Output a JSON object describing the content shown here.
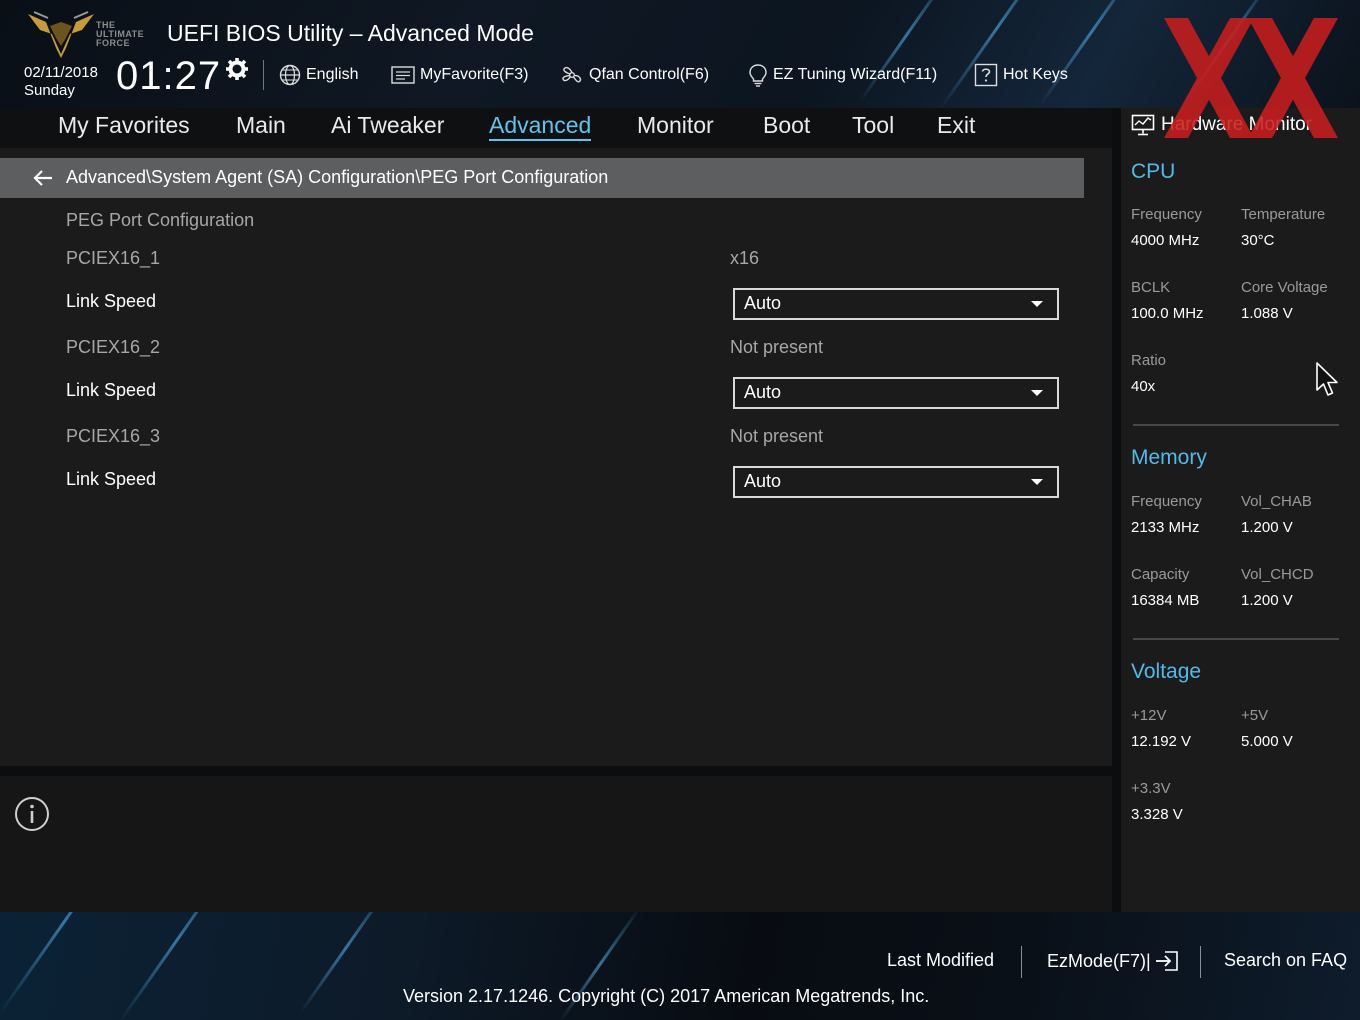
{
  "header": {
    "logo_text": "THE ULTIMATE FORCE",
    "title": "UEFI BIOS Utility – Advanced Mode",
    "date": "02/11/2018",
    "day": "Sunday",
    "time": "01:27",
    "toolbar": [
      {
        "label": "English",
        "icon": "globe-icon"
      },
      {
        "label": "MyFavorite(F3)",
        "icon": "favorite-list-icon"
      },
      {
        "label": "Qfan Control(F6)",
        "icon": "fan-icon"
      },
      {
        "label": "EZ Tuning Wizard(F11)",
        "icon": "lightbulb-icon"
      },
      {
        "label": "Hot Keys",
        "icon": "help-box-icon"
      }
    ]
  },
  "menu": {
    "tabs": [
      "My Favorites",
      "Main",
      "Ai Tweaker",
      "Advanced",
      "Monitor",
      "Boot",
      "Tool",
      "Exit"
    ],
    "active": "Advanced"
  },
  "main": {
    "breadcrumb": "Advanced\\System Agent (SA) Configuration\\PEG Port Configuration",
    "section_title": "PEG Port Configuration",
    "ports": [
      {
        "name": "PCIEX16_1",
        "status": "x16",
        "setting_label": "Link Speed",
        "setting_value": "Auto"
      },
      {
        "name": "PCIEX16_2",
        "status": "Not present",
        "setting_label": "Link Speed",
        "setting_value": "Auto"
      },
      {
        "name": "PCIEX16_3",
        "status": "Not present",
        "setting_label": "Link Speed",
        "setting_value": "Auto"
      }
    ]
  },
  "hardware_monitor": {
    "title": "Hardware Monitor",
    "cpu": {
      "heading": "CPU",
      "frequency_label": "Frequency",
      "frequency": "4000 MHz",
      "temperature_label": "Temperature",
      "temperature": "30°C",
      "bclk_label": "BCLK",
      "bclk": "100.0 MHz",
      "core_voltage_label": "Core Voltage",
      "core_voltage": "1.088 V",
      "ratio_label": "Ratio",
      "ratio": "40x"
    },
    "memory": {
      "heading": "Memory",
      "frequency_label": "Frequency",
      "frequency": "2133 MHz",
      "vol_chab_label": "Vol_CHAB",
      "vol_chab": "1.200 V",
      "capacity_label": "Capacity",
      "capacity": "16384 MB",
      "vol_chcd_label": "Vol_CHCD",
      "vol_chcd": "1.200 V"
    },
    "voltage": {
      "heading": "Voltage",
      "v12_label": "+12V",
      "v12": "12.192 V",
      "v5_label": "+5V",
      "v5": "5.000 V",
      "v33_label": "+3.3V",
      "v33": "3.328 V"
    }
  },
  "footer": {
    "last_modified": "Last Modified",
    "ezmode": "EzMode(F7)|",
    "search_faq": "Search on FAQ",
    "version": "Version 2.17.1246. Copyright (C) 2017 American Megatrends, Inc."
  },
  "colors": {
    "accent_blue": "#53b9e8",
    "active_tab": "#5fc4f0",
    "breadcrumb_bg": "#5d5e60",
    "panel_bg": "#1b1b1c",
    "watermark_red": "#c81e1e"
  }
}
